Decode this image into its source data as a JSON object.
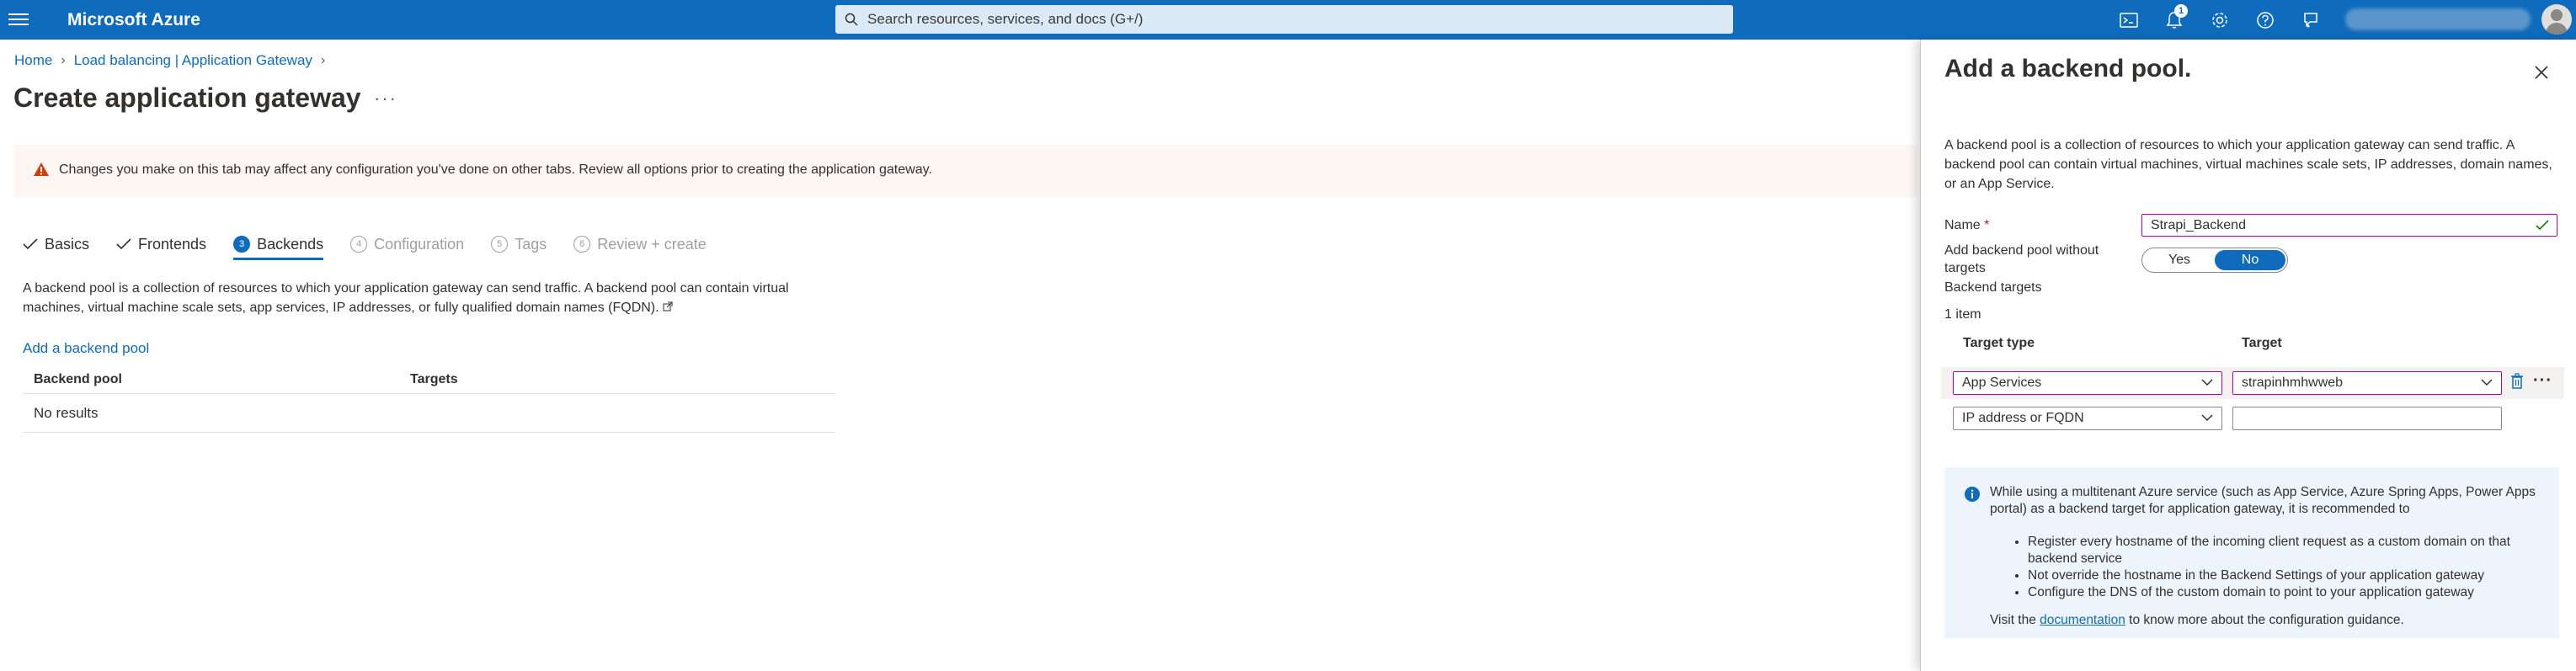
{
  "topbar": {
    "brand": "Microsoft Azure",
    "search_placeholder": "Search resources, services, and docs (G+/)",
    "notification_count": "1"
  },
  "breadcrumb": {
    "items": [
      "Home",
      "Load balancing | Application Gateway"
    ]
  },
  "page": {
    "title": "Create application gateway"
  },
  "warning": {
    "text": "Changes you make on this tab may affect any configuration you've done on other tabs. Review all options prior to creating the application gateway."
  },
  "tabs": [
    {
      "label": "Basics",
      "state": "done"
    },
    {
      "label": "Frontends",
      "state": "done"
    },
    {
      "label": "Backends",
      "state": "active",
      "number": "3"
    },
    {
      "label": "Configuration",
      "state": "disabled",
      "number": "4"
    },
    {
      "label": "Tags",
      "state": "disabled",
      "number": "5"
    },
    {
      "label": "Review + create",
      "state": "disabled",
      "number": "6"
    }
  ],
  "backends": {
    "description": "A backend pool is a collection of resources to which your application gateway can send traffic. A backend pool can contain virtual machines, virtual machine scale sets, app services, IP addresses, or fully qualified domain names (FQDN).",
    "add_link": "Add a backend pool",
    "columns": [
      "Backend pool",
      "Targets"
    ],
    "empty_text": "No results"
  },
  "panel": {
    "title": "Add a backend pool.",
    "description": "A backend pool is a collection of resources to which your application gateway can send traffic. A backend pool can contain virtual machines, virtual machines scale sets, IP addresses, domain names, or an App Service.",
    "name_label": "Name",
    "required_marker": "*",
    "name_value": "Strapi_Backend",
    "without_targets_label": "Add backend pool without targets",
    "toggle_yes": "Yes",
    "toggle_no": "No",
    "toggle_selected": "No",
    "backend_targets_label": "Backend targets",
    "item_count": "1 item",
    "target_type_header": "Target type",
    "target_header": "Target",
    "rows": [
      {
        "type": "App Services",
        "target": "strapinhmhwweb"
      },
      {
        "type": "IP address or FQDN",
        "target": ""
      }
    ],
    "info": {
      "text": "While using a multitenant Azure service (such as App Service, Azure Spring Apps, Power Apps portal) as a backend target for application gateway, it is recommended to",
      "bullets": [
        "Register every hostname of the incoming client request as a custom domain on that backend service",
        "Not override the hostname in the Backend Settings of your application gateway",
        "Configure the DNS of the custom domain to point to your application gateway"
      ],
      "visit_prefix": "Visit the",
      "visit_link": "documentation",
      "visit_suffix": "to know more about the configuration guidance."
    }
  },
  "colors": {
    "brand": "#0f6cbd",
    "warning_bg": "#fdf6f3",
    "warning_icon": "#d83b01",
    "info_bg": "#eef4fb",
    "focus_border": "#b4009e",
    "valid_check": "#107c10"
  }
}
